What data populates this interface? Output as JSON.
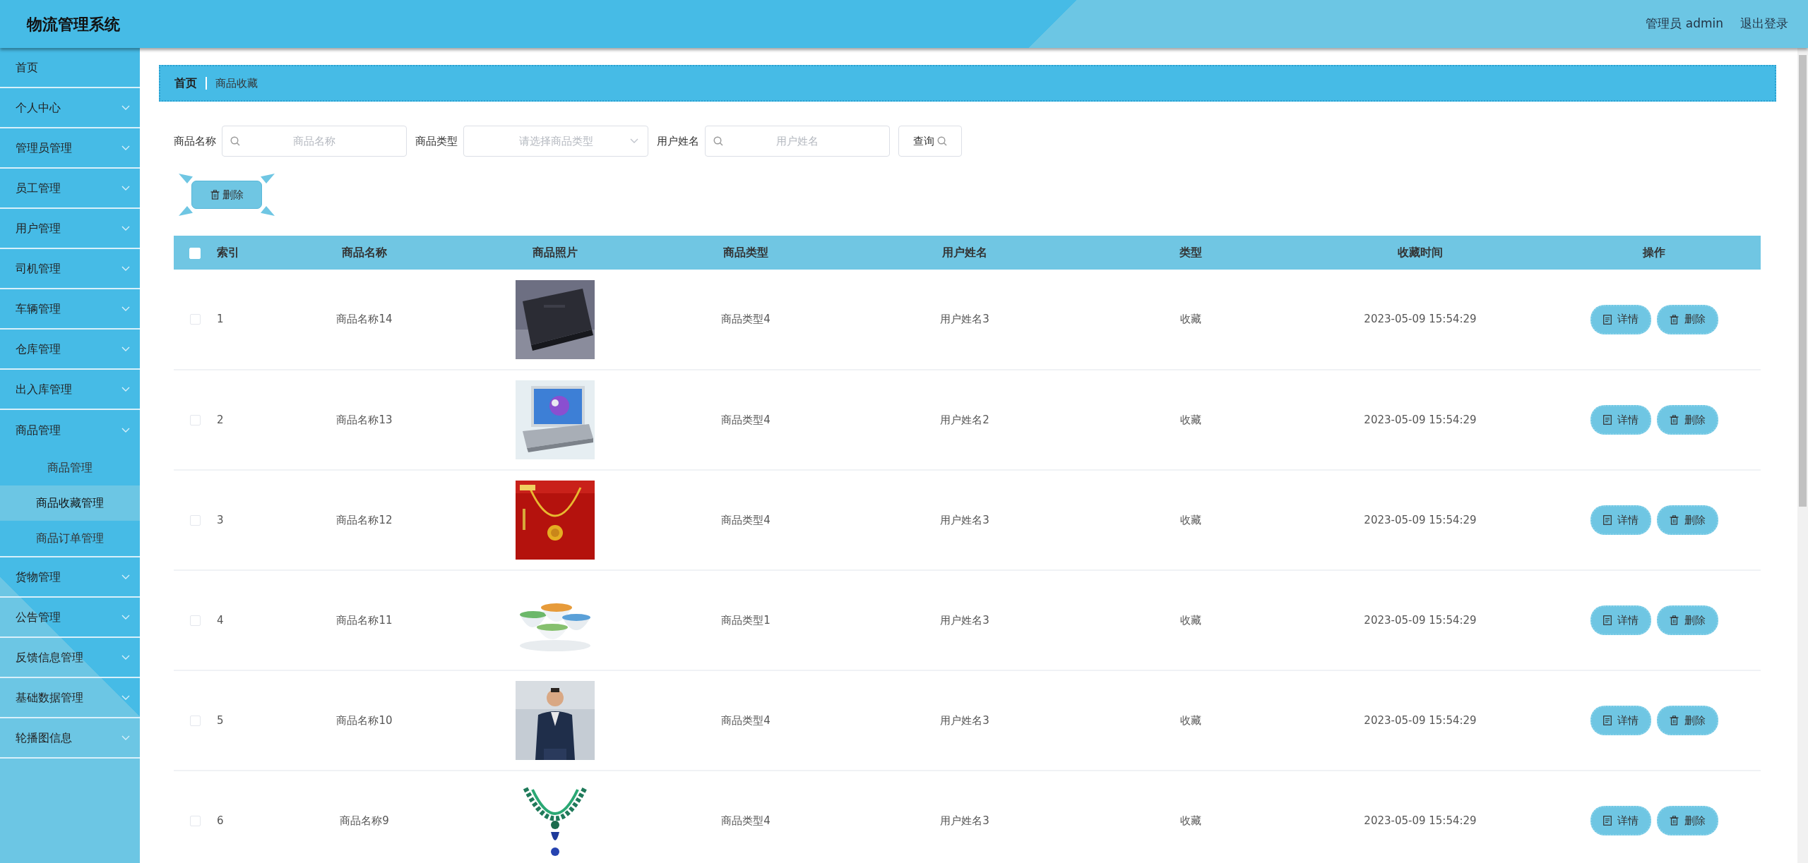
{
  "header": {
    "title": "物流管理系统",
    "user": "管理员 admin",
    "logout": "退出登录"
  },
  "sidebar": {
    "items": [
      {
        "label": "首页",
        "kind": "link"
      },
      {
        "label": "个人中心",
        "kind": "menu"
      },
      {
        "label": "管理员管理",
        "kind": "menu"
      },
      {
        "label": "员工管理",
        "kind": "menu"
      },
      {
        "label": "用户管理",
        "kind": "menu"
      },
      {
        "label": "司机管理",
        "kind": "menu"
      },
      {
        "label": "车辆管理",
        "kind": "menu"
      },
      {
        "label": "仓库管理",
        "kind": "menu"
      },
      {
        "label": "出入库管理",
        "kind": "menu"
      },
      {
        "label": "商品管理",
        "kind": "menu",
        "expanded": true,
        "children": [
          {
            "label": "商品管理",
            "selected": false
          },
          {
            "label": "商品收藏管理",
            "selected": true
          },
          {
            "label": "商品订单管理",
            "selected": false
          }
        ]
      },
      {
        "label": "货物管理",
        "kind": "menu"
      },
      {
        "label": "公告管理",
        "kind": "menu"
      },
      {
        "label": "反馈信息管理",
        "kind": "menu"
      },
      {
        "label": "基础数据管理",
        "kind": "menu"
      },
      {
        "label": "轮播图信息",
        "kind": "menu"
      }
    ]
  },
  "breadcrumb": [
    "首页",
    "商品收藏"
  ],
  "filters": [
    {
      "label": "商品名称",
      "kind": "text",
      "placeholder": "商品名称"
    },
    {
      "label": "商品类型",
      "kind": "select",
      "placeholder": "请选择商品类型"
    },
    {
      "label": "用户姓名",
      "kind": "text",
      "placeholder": "用户姓名"
    }
  ],
  "search_button": "查询",
  "bulk_delete_button": "删除",
  "table": {
    "header_checkbox": {
      "checked": false
    },
    "columns": [
      "索引",
      "商品名称",
      "商品照片",
      "商品类型",
      "用户姓名",
      "类型",
      "收藏时间",
      "操作"
    ],
    "rows": [
      {
        "checked": false,
        "index": "1",
        "name": "商品名称14",
        "photo": {
          "kind": "picture"
        },
        "type": "商品类型4",
        "user": "用户姓名3",
        "category": "收藏",
        "time": "2023-05-09 15:54:29",
        "actions": [
          "详情",
          "删除"
        ]
      },
      {
        "checked": false,
        "index": "2",
        "name": "商品名称13",
        "photo": {
          "kind": "picture"
        },
        "type": "商品类型4",
        "user": "用户姓名2",
        "category": "收藏",
        "time": "2023-05-09 15:54:29",
        "actions": [
          "详情",
          "删除"
        ]
      },
      {
        "checked": false,
        "index": "3",
        "name": "商品名称12",
        "photo": {
          "kind": "picture"
        },
        "type": "商品类型4",
        "user": "用户姓名3",
        "category": "收藏",
        "time": "2023-05-09 15:54:29",
        "actions": [
          "详情",
          "删除"
        ]
      },
      {
        "checked": false,
        "index": "4",
        "name": "商品名称11",
        "photo": {
          "kind": "picture"
        },
        "type": "商品类型1",
        "user": "用户姓名3",
        "category": "收藏",
        "time": "2023-05-09 15:54:29",
        "actions": [
          "详情",
          "删除"
        ]
      },
      {
        "checked": false,
        "index": "5",
        "name": "商品名称10",
        "photo": {
          "kind": "picture"
        },
        "type": "商品类型4",
        "user": "用户姓名3",
        "category": "收藏",
        "time": "2023-05-09 15:54:29",
        "actions": [
          "详情",
          "删除"
        ]
      },
      {
        "checked": false,
        "index": "6",
        "name": "商品名称9",
        "photo": {
          "kind": "picture"
        },
        "type": "商品类型4",
        "user": "用户姓名3",
        "category": "收藏",
        "time": "2023-05-09 15:54:29",
        "actions": [
          "详情",
          "删除"
        ]
      }
    ]
  }
}
